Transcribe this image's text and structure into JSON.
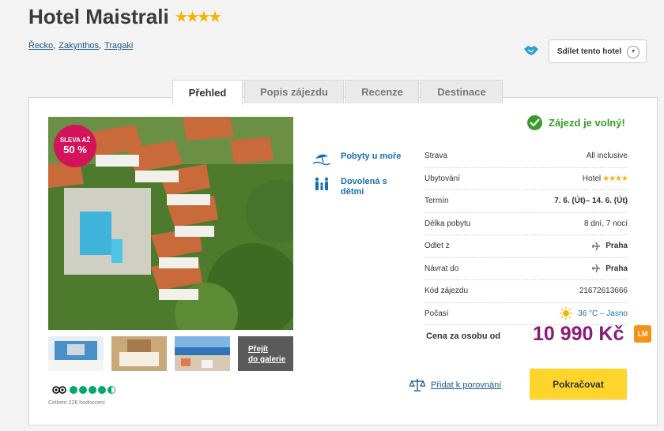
{
  "hotel": {
    "name": "Hotel Maistrali",
    "stars": "★★★★"
  },
  "breadcrumb": {
    "items": [
      "Řecko",
      "Zakynthos",
      "Tragaki"
    ]
  },
  "share": {
    "label": "Sdílet tento hotel"
  },
  "tabs": [
    {
      "label": "Přehled",
      "active": true
    },
    {
      "label": "Popis zájezdu"
    },
    {
      "label": "Recenze"
    },
    {
      "label": "Destinace"
    }
  ],
  "badge": {
    "line1": "SLEVA AŽ",
    "line2": "50 %"
  },
  "gallery": {
    "line1": "Přejít",
    "line2": "do galerie"
  },
  "rating": {
    "count_text": "Celkem 226 hodnocení",
    "score": 4.5
  },
  "features": [
    {
      "label": "Pobyty u moře",
      "icon": "beach-icon"
    },
    {
      "label": "Dovolená s dětmi",
      "icon": "family-icon"
    }
  ],
  "availability": {
    "text": "Zájezd je volný!"
  },
  "details": {
    "board": {
      "label": "Strava",
      "value": "All inclusive"
    },
    "accommodation": {
      "label": "Ubytování",
      "value": "Hotel",
      "stars": "★★★★"
    },
    "term": {
      "label": "Termín",
      "value": "7. 6. (Út)– 14. 6. (Út)"
    },
    "length": {
      "label": "Délka pobytu",
      "value": "8 dní, 7 nocí"
    },
    "departure": {
      "label": "Odlet z",
      "value": "Praha"
    },
    "return": {
      "label": "Návrat do",
      "value": "Praha"
    },
    "code": {
      "label": "Kód zájezdu",
      "value": "21672613666"
    },
    "weather": {
      "label": "Počasí",
      "value": "36 °C – Jasno"
    }
  },
  "price": {
    "label": "Cena za osobu od",
    "value": "10 990 Kč",
    "badge": "LM"
  },
  "compare": {
    "label": "Přidat k porovnání"
  },
  "continue": {
    "label": "Pokračovat"
  },
  "colors": {
    "price": "#8b1a7a",
    "accent_yellow": "#ffd42b",
    "link_blue": "#1a6fb0",
    "available_green": "#3a9b2a",
    "badge_pink": "#d4145a",
    "lm_orange": "#f39214"
  }
}
